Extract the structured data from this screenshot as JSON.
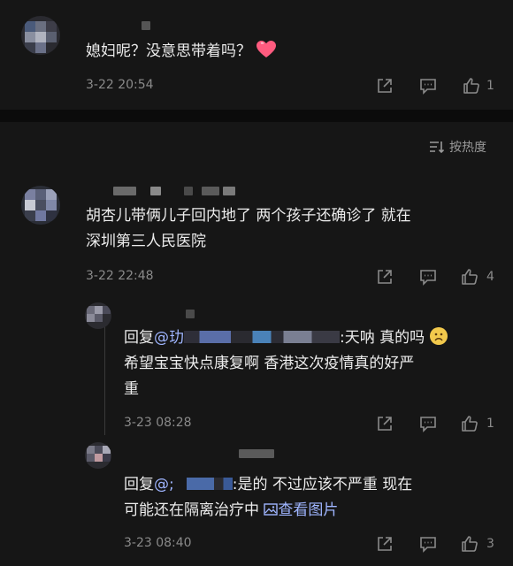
{
  "comments": [
    {
      "text": "媳妇呢？没意思带着吗？",
      "time": "3-22 20:54",
      "likes": "1"
    },
    {
      "text_line1": "胡杏儿带俩儿子回内地了 两个孩子还确诊了 就在",
      "text_line2": "深圳第三人民医院",
      "time": "3-22 22:48",
      "likes": "4"
    }
  ],
  "sort": {
    "label": "按热度"
  },
  "replies": [
    {
      "prefix": "回复",
      "mention": "@玏",
      "line1_tail": ":天呐 真的吗",
      "line2": "希望宝宝快点康复啊 香港这次疫情真的好严",
      "line3": "重",
      "time": "3-23 08:28",
      "likes": "1"
    },
    {
      "prefix": "回复",
      "mention": "@;",
      "line1_tail": ":是的 不过应该不严重 现在",
      "line2": "可能还在隔离治疗中",
      "link": "查看图片",
      "time": "3-23 08:40",
      "likes": "3"
    }
  ],
  "icons": [
    "share-icon",
    "comment-icon",
    "thumbs-up-icon",
    "sort-icon",
    "heart-emoji-icon",
    "worried-emoji-icon",
    "image-icon"
  ]
}
